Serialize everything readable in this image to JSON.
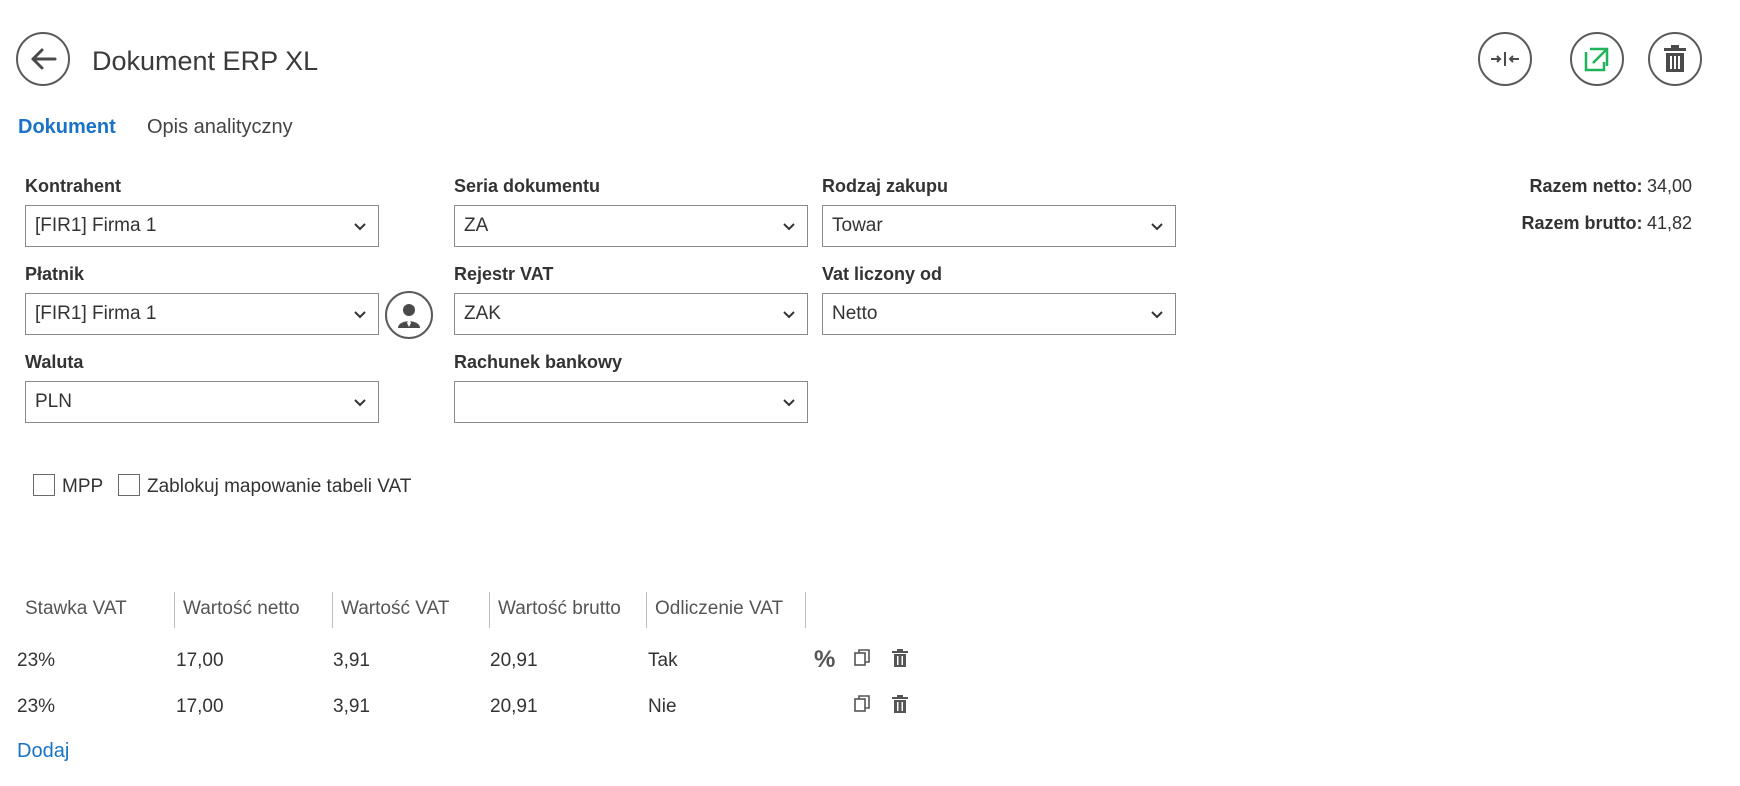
{
  "header": {
    "title": "Dokument ERP XL",
    "buttons": {
      "back_icon": "arrow-left-icon",
      "collapse_icon": "collapse-icon",
      "open_external_icon": "external-link-icon",
      "delete_icon": "trash-icon"
    },
    "accent_green": "#20b45a"
  },
  "tabs": [
    {
      "label": "Dokument",
      "active": true
    },
    {
      "label": "Opis analityczny",
      "active": false
    }
  ],
  "form": {
    "kontrahent": {
      "label": "Kontrahent",
      "value": "[FIR1] Firma 1"
    },
    "platnik": {
      "label": "Płatnik",
      "value": "[FIR1] Firma 1"
    },
    "waluta": {
      "label": "Waluta",
      "value": "PLN"
    },
    "seria": {
      "label": "Seria dokumentu",
      "value": "ZA"
    },
    "rejestr": {
      "label": "Rejestr VAT",
      "value": "ZAK"
    },
    "rachunek": {
      "label": "Rachunek bankowy",
      "value": ""
    },
    "rodzaj": {
      "label": "Rodzaj zakupu",
      "value": "Towar"
    },
    "vat_od": {
      "label": "Vat liczony od",
      "value": "Netto"
    }
  },
  "totals": {
    "netto_label": "Razem netto:",
    "netto_value": "34,00",
    "brutto_label": "Razem brutto:",
    "brutto_value": "41,82"
  },
  "checkboxes": [
    {
      "label": "MPP",
      "checked": false
    },
    {
      "label": "Zablokuj mapowanie tabeli VAT",
      "checked": false
    }
  ],
  "vat_table": {
    "columns": [
      "Stawka VAT",
      "Wartość netto",
      "Wartość VAT",
      "Wartość brutto",
      "Odliczenie VAT"
    ],
    "rows": [
      {
        "stawka": "23%",
        "netto": "17,00",
        "vat": "3,91",
        "brutto": "20,91",
        "odliczenie": "Tak",
        "percent_icon": "%"
      },
      {
        "stawka": "23%",
        "netto": "17,00",
        "vat": "3,91",
        "brutto": "20,91",
        "odliczenie": "Nie",
        "percent_icon": ""
      }
    ],
    "add_label": "Dodaj"
  }
}
